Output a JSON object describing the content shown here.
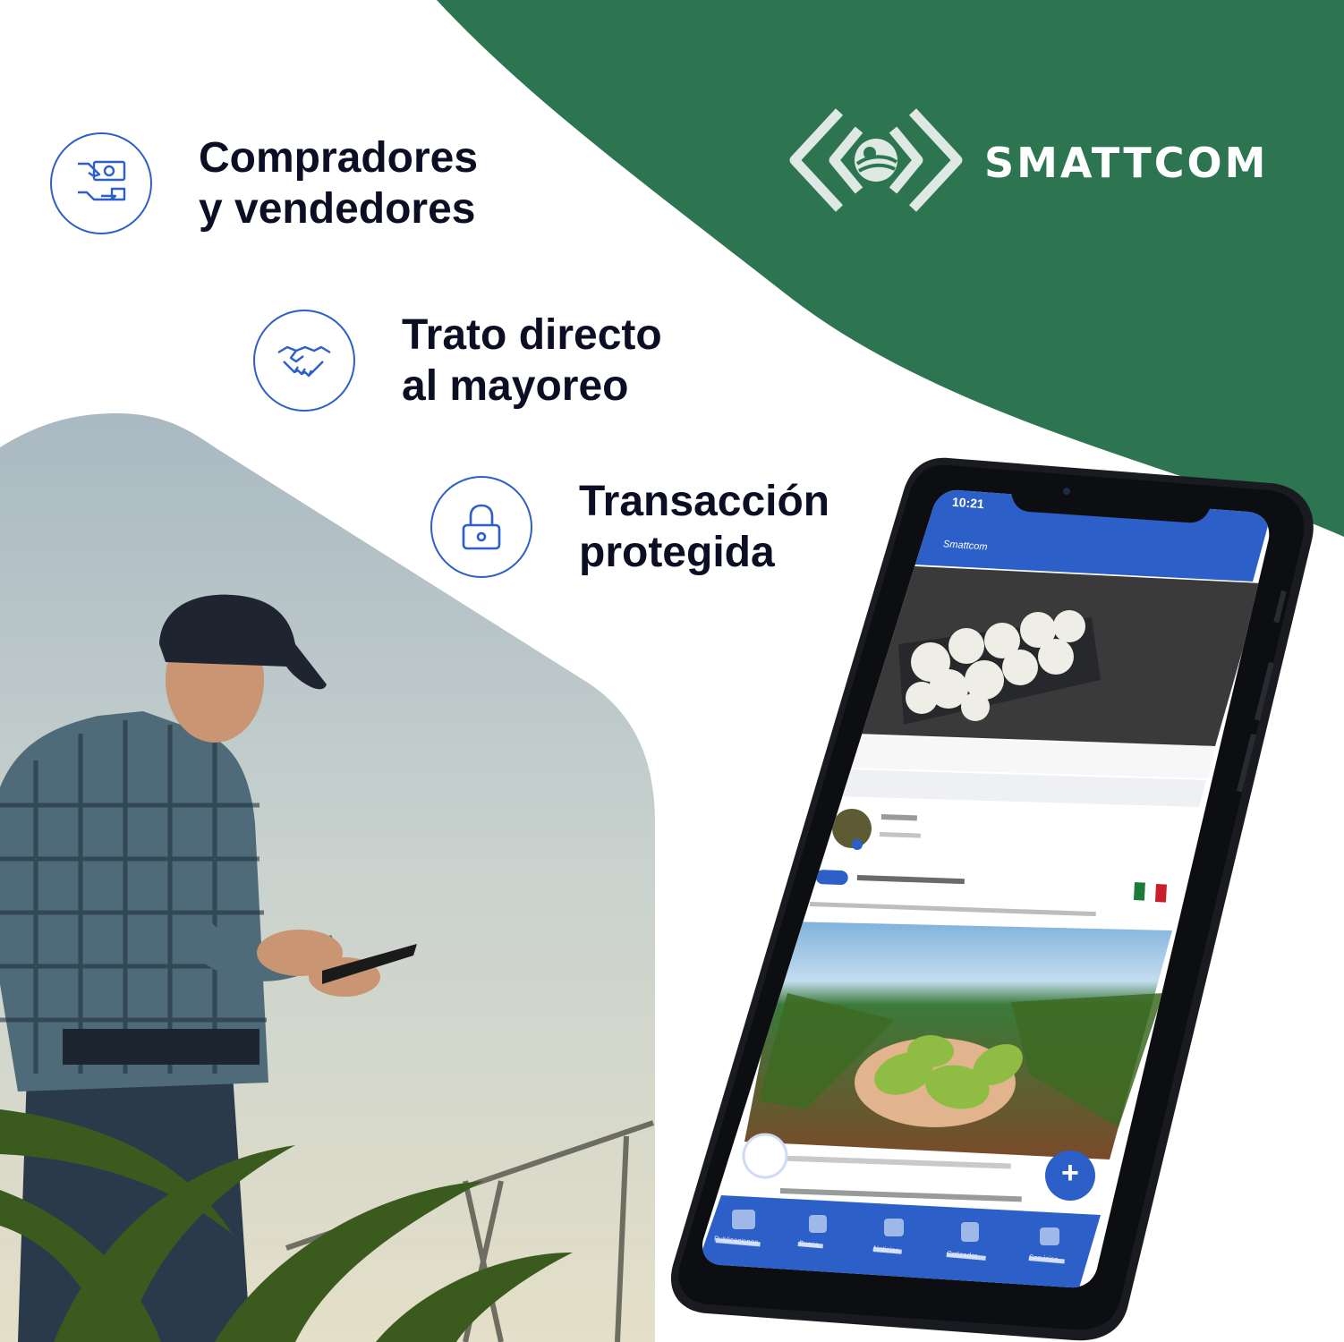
{
  "brand": {
    "name": "SMATTCOM",
    "colors": {
      "green": "#2d7550",
      "blue": "#2d5fc8",
      "text": "#0c0f24"
    }
  },
  "features": [
    {
      "icon": "money-hand-icon",
      "line1": "Compradores",
      "line2": "y vendedores"
    },
    {
      "icon": "handshake-icon",
      "line1": "Trato directo",
      "line2": "al mayoreo"
    },
    {
      "icon": "padlock-icon",
      "line1": "Transacción",
      "line2": "protegida"
    }
  ],
  "phone_screen": {
    "time": "10:21",
    "header_title": "Smattcom",
    "fab_label": "+",
    "nav": [
      {
        "icon": "feed-icon",
        "label": "Publicaciones"
      },
      {
        "icon": "search-icon",
        "label": "Busca"
      },
      {
        "icon": "news-icon",
        "label": "Noticias"
      },
      {
        "icon": "calculator-icon",
        "label": "Cotizador"
      },
      {
        "icon": "tools-icon",
        "label": "Servicios"
      }
    ]
  }
}
